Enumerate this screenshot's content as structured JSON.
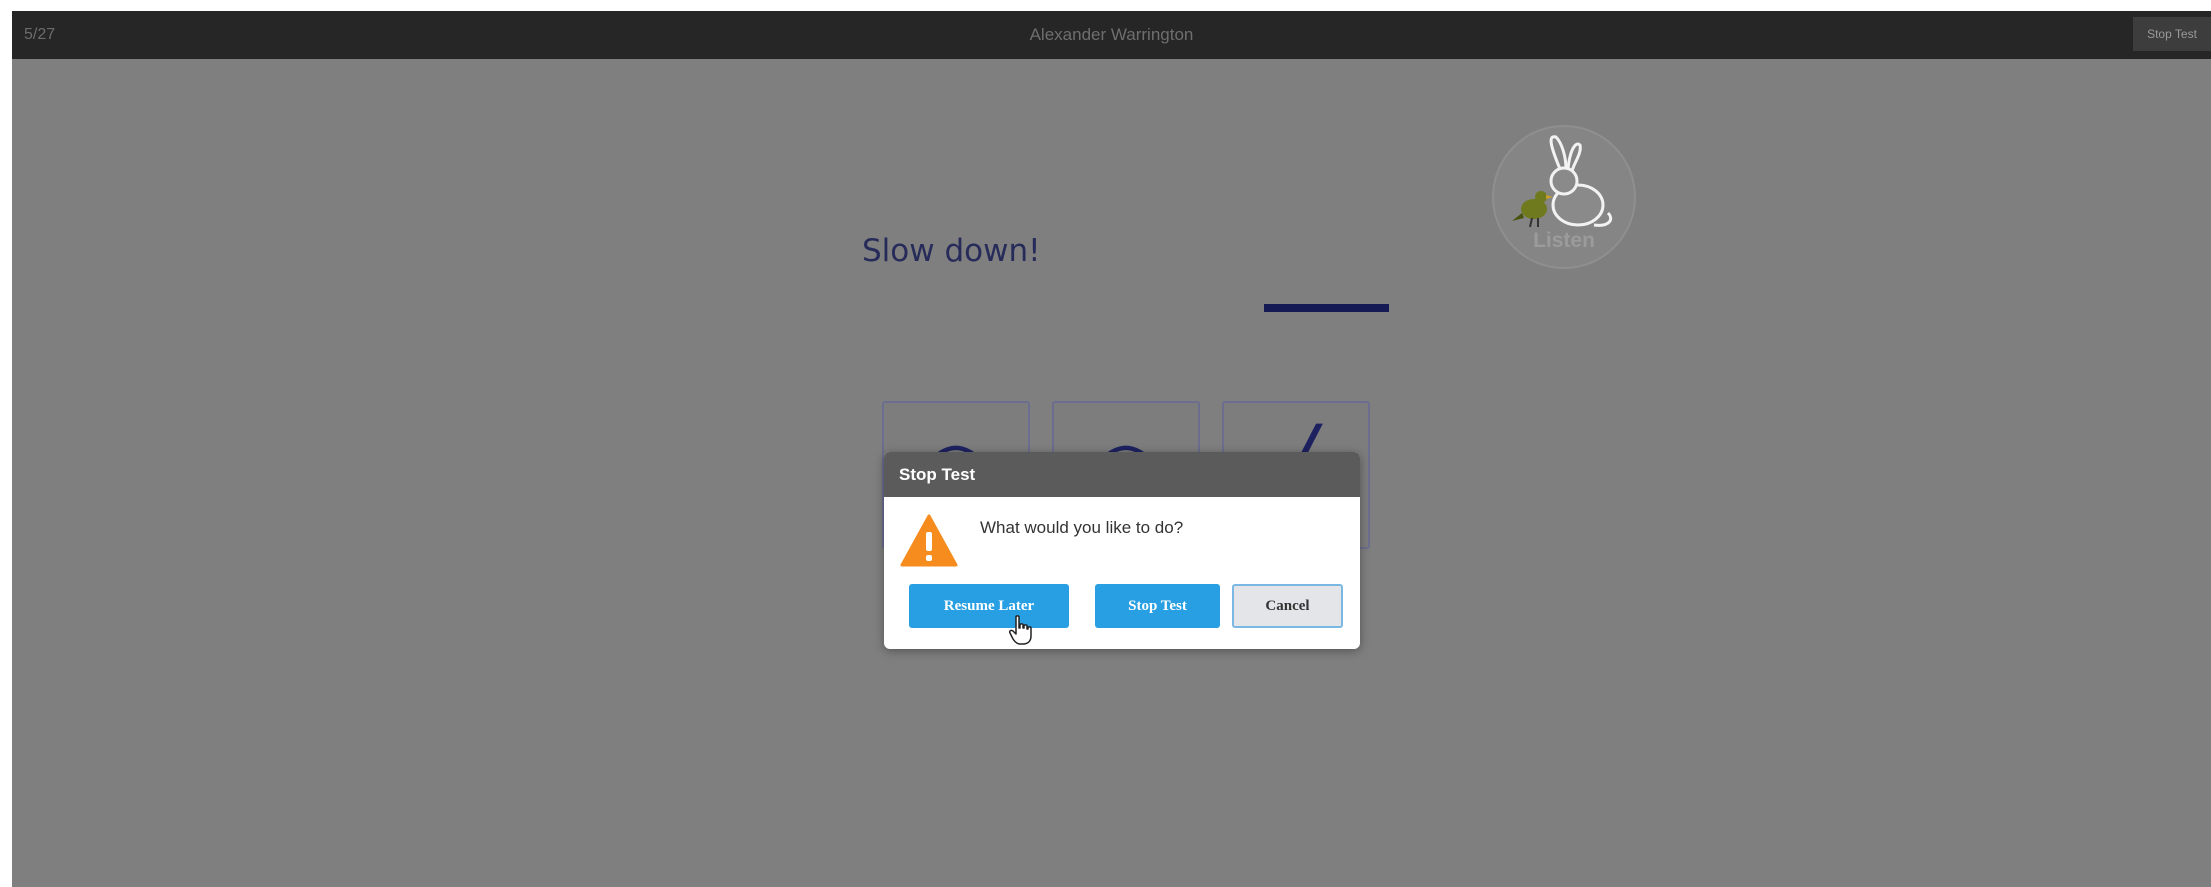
{
  "header": {
    "progress": "5/27",
    "student_name": "Alexander Warrington",
    "stop_label": "Stop Test"
  },
  "prompt": {
    "instruction": "Slow down!",
    "listen_label": "Listen"
  },
  "dialog": {
    "title": "Stop Test",
    "question": "What would you like to do?",
    "buttons": {
      "resume": "Resume Later",
      "stop": "Stop Test",
      "cancel": "Cancel"
    }
  },
  "colors": {
    "overlay": "#7f7f7f",
    "topbar": "#262626",
    "primary_button": "#289fe3",
    "warning": "#f68c1e",
    "ink": "#1d2160"
  },
  "icons": {
    "warning": "warning-triangle-icon",
    "listen": "rabbit-bird-listen-icon",
    "cursor": "hand-pointer-cursor-icon"
  }
}
